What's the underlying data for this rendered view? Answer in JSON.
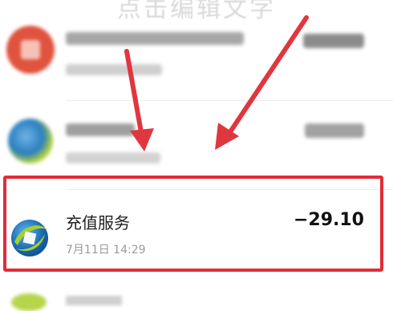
{
  "header": {
    "blurred_title": "点击编辑文字"
  },
  "rows": [
    {
      "title": "",
      "time": "7月11日 15:08",
      "amount": "−8.00",
      "logo": "red-square-logo",
      "obscured": true
    },
    {
      "title": "",
      "time": "",
      "amount": "",
      "logo": "green-blue-logo",
      "obscured": true
    },
    {
      "title": "充值服务",
      "time": "7月11日 14:29",
      "amount": "−29.10",
      "logo": "recharge-service-logo",
      "obscured": false
    }
  ],
  "colors": {
    "highlight": "#e22c36",
    "arrow": "#e0363f"
  }
}
